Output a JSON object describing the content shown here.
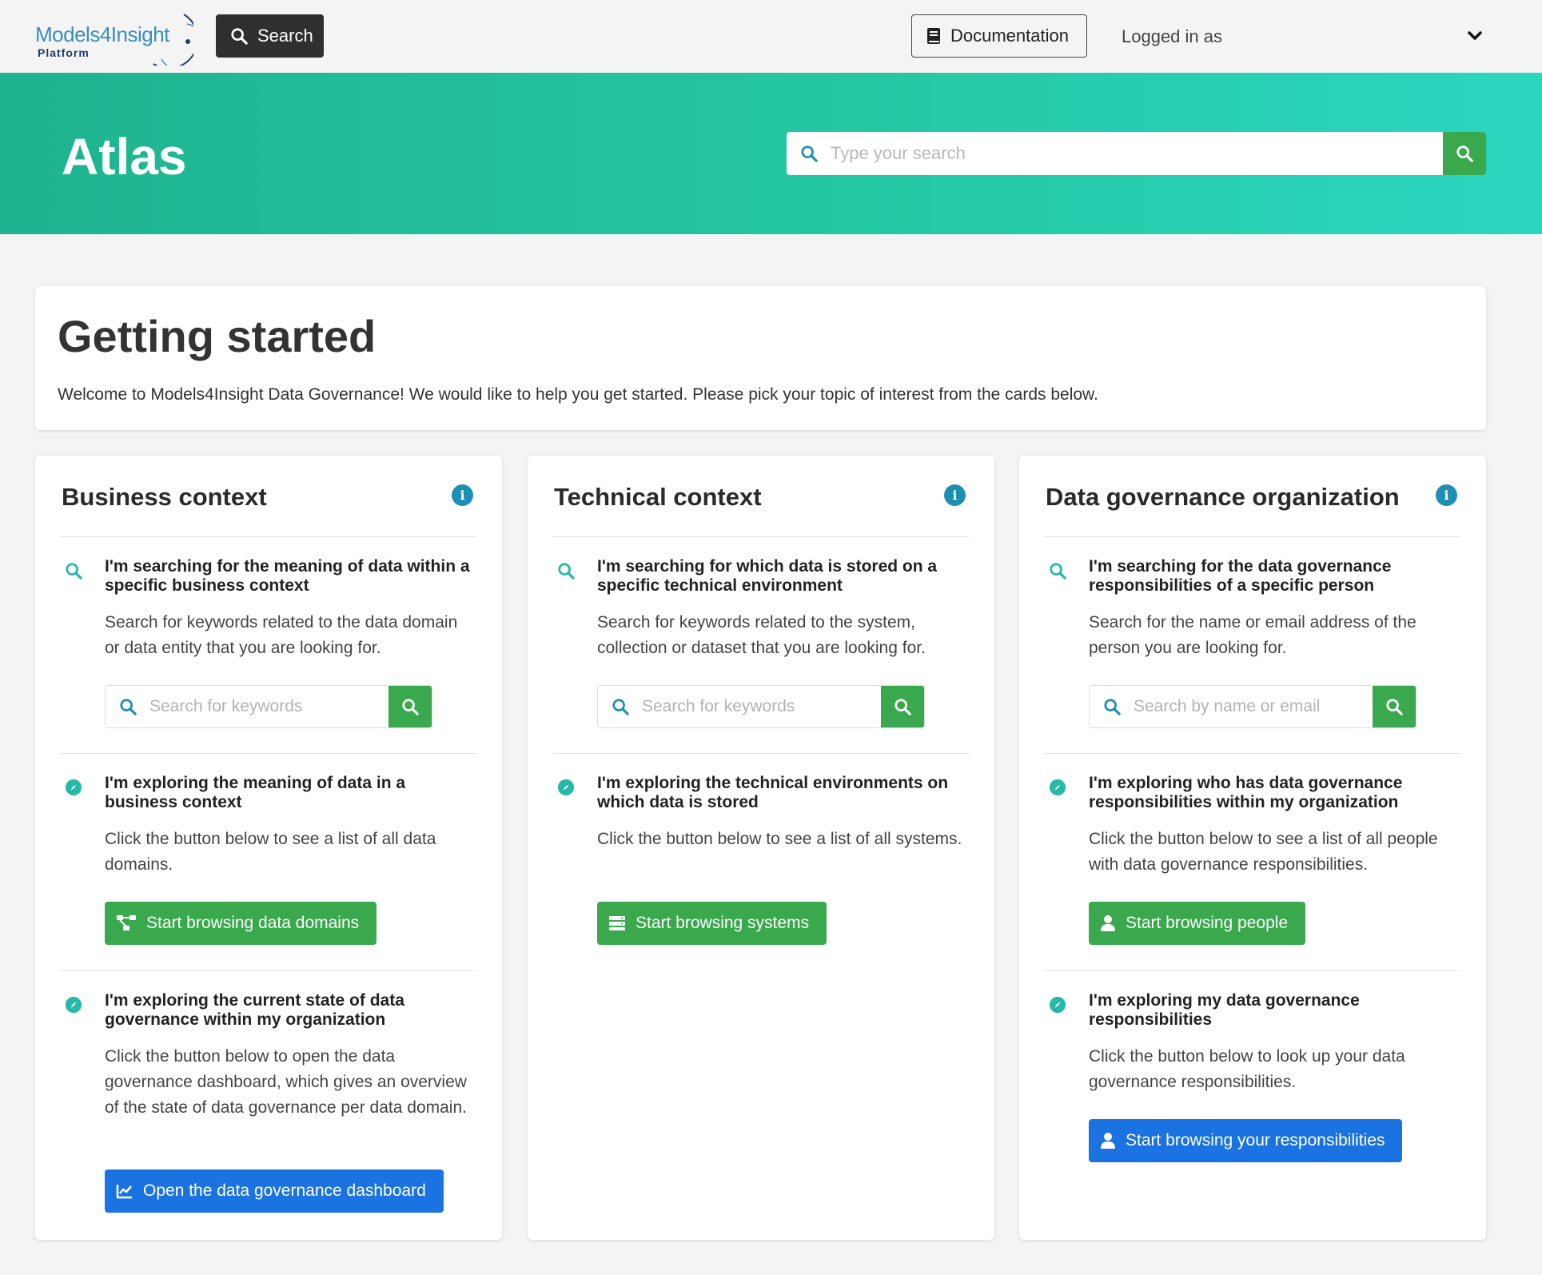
{
  "navbar": {
    "logo_main": "Models4Insight",
    "logo_sub": "Platform",
    "search_label": "Search",
    "documentation_label": "Documentation",
    "logged_in_label": "Logged in as"
  },
  "hero": {
    "title": "Atlas",
    "search_placeholder": "Type your search"
  },
  "getting_started": {
    "title": "Getting started",
    "text": "Welcome to Models4Insight Data Governance! We would like to help you get started. Please pick your topic of interest from the cards below."
  },
  "cards": [
    {
      "title": "Business context",
      "sections": [
        {
          "heading": "I'm searching for the meaning of data within a specific business context",
          "text": "Search for keywords related to the data domain or data entity that you are looking for.",
          "search_placeholder": "Search for keywords"
        },
        {
          "heading": "I'm exploring the meaning of data in a business context",
          "text": "Click the button below to see a list of all data domains.",
          "button": "Start browsing data domains"
        },
        {
          "heading": "I'm exploring the current state of data governance within my organization",
          "text": "Click the button below to open the data governance dashboard, which gives an overview of the state of data governance per data domain.",
          "button": "Open the data governance dashboard"
        }
      ]
    },
    {
      "title": "Technical context",
      "sections": [
        {
          "heading": "I'm searching for which data is stored on a specific technical environment",
          "text": "Search for keywords related to the system, collection or dataset that you are looking for.",
          "search_placeholder": "Search for keywords"
        },
        {
          "heading": "I'm exploring the technical environments on which data is stored",
          "text": "Click the button below to see a list of all systems.",
          "button": "Start browsing systems"
        }
      ]
    },
    {
      "title": "Data governance organization",
      "sections": [
        {
          "heading": "I'm searching for the data governance responsibilities of a specific person",
          "text": "Search for the name or email address of the person you are looking for.",
          "search_placeholder": "Search by name or email"
        },
        {
          "heading": "I'm exploring who has data governance responsibilities within my organization",
          "text": "Click the button below to see a list of all people with data governance responsibilities.",
          "button": "Start browsing people"
        },
        {
          "heading": "I'm exploring my data governance responsibilities",
          "text": "Click the button below to look up your data governance responsibilities.",
          "button": "Start browsing your responsibilities"
        }
      ]
    }
  ],
  "colors": {
    "accent_teal": "#25c7a4",
    "button_green": "#3aa84c",
    "button_blue": "#1a73e0",
    "info_blue": "#1e8fb3",
    "icon_teal": "#26b9a8"
  },
  "icons": {
    "search": "search-icon",
    "compass": "compass-icon",
    "info": "info-icon",
    "book": "book-icon",
    "chevron": "chevron-down-icon",
    "sitemap": "sitemap-icon",
    "server": "server-icon",
    "user": "user-icon",
    "chart": "chart-line-icon"
  }
}
